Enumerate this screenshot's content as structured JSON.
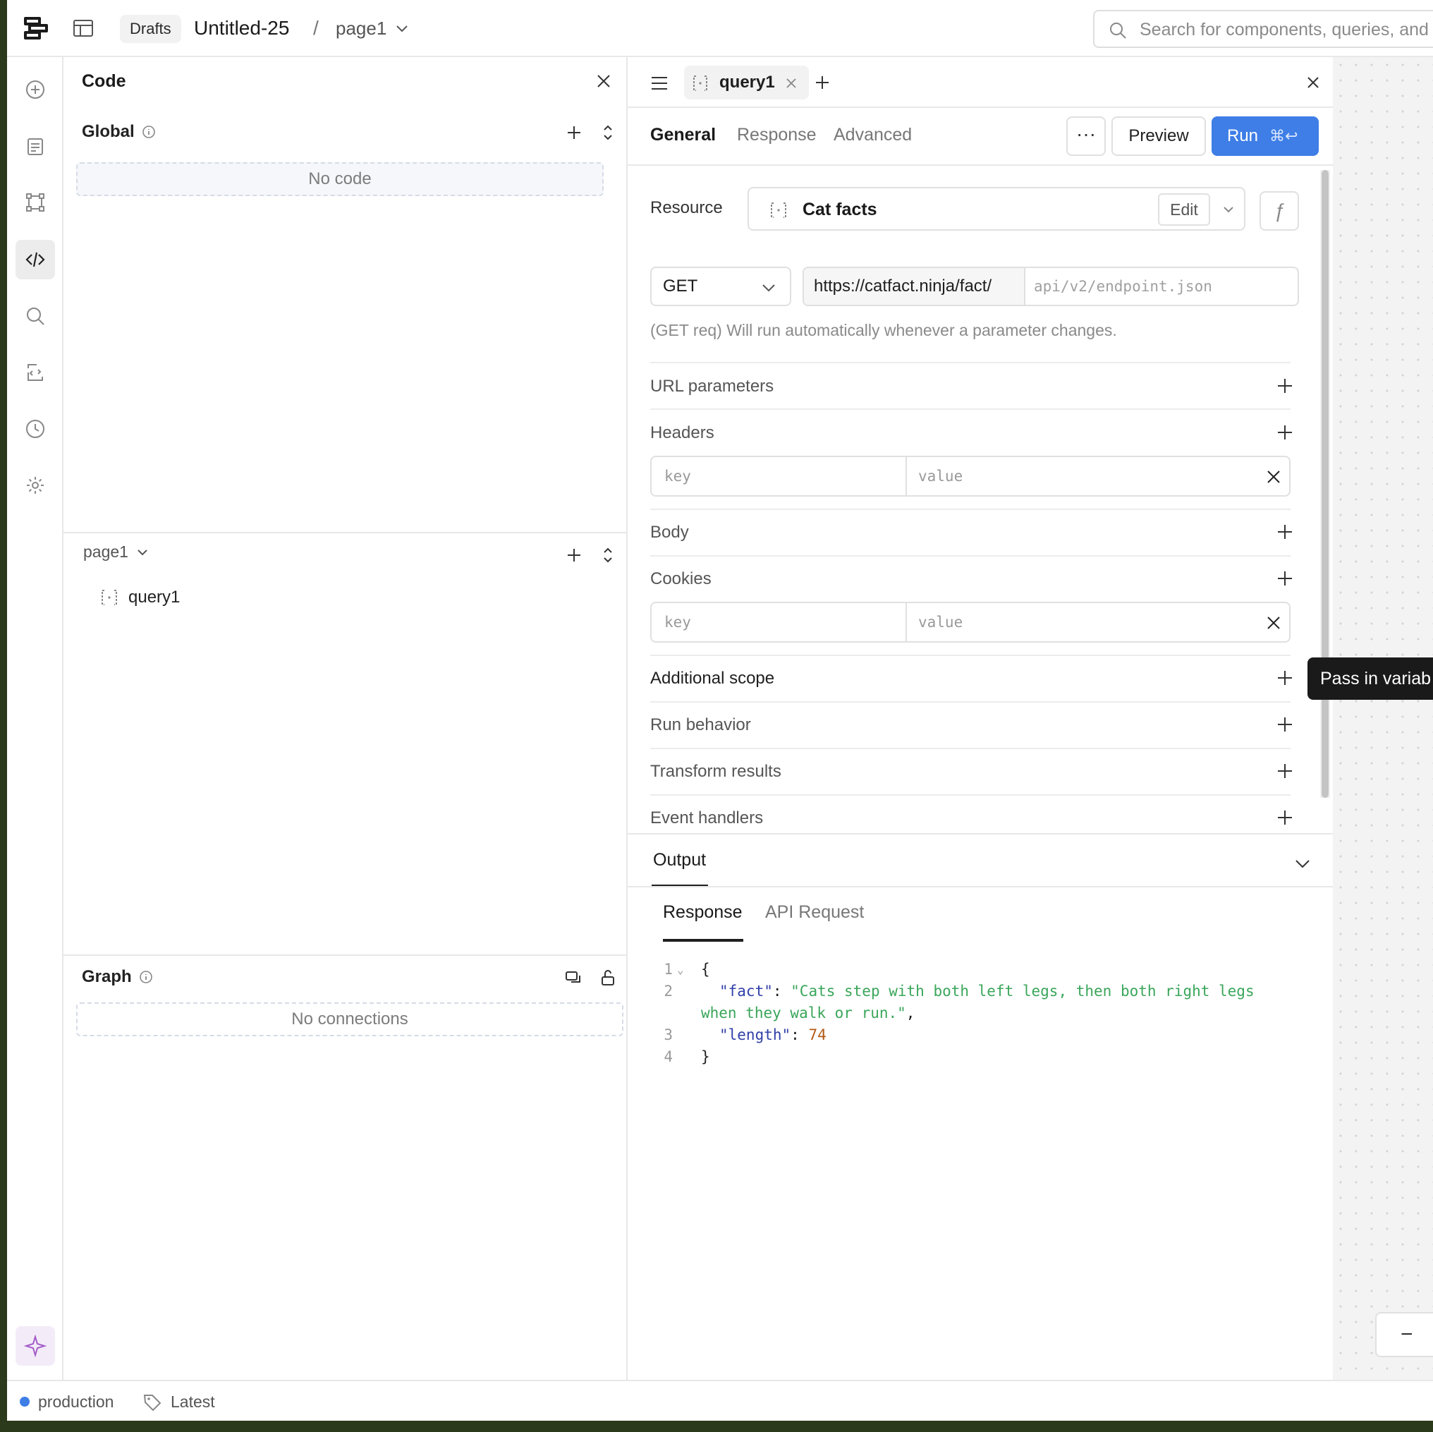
{
  "header": {
    "drafts_label": "Drafts",
    "app_title": "Untitled-25",
    "separator": "/",
    "page_name": "page1",
    "search_placeholder": "Search for components, queries, and"
  },
  "code_panel": {
    "title": "Code",
    "global": {
      "label": "Global",
      "empty_text": "No code"
    },
    "page": {
      "label": "page1",
      "items": [
        {
          "name": "query1"
        }
      ]
    },
    "graph": {
      "label": "Graph",
      "empty_text": "No connections"
    }
  },
  "editor": {
    "tab_name": "query1",
    "subtabs": [
      "General",
      "Response",
      "Advanced"
    ],
    "more_label": "···",
    "preview_label": "Preview",
    "run_label": "Run",
    "run_shortcut": "⌘↩",
    "resource_label": "Resource",
    "resource_name": "Cat facts",
    "edit_label": "Edit",
    "fx_label": "ƒ",
    "method": "GET",
    "url_base": "https://catfact.ninja/fact/",
    "url_placeholder": "api/v2/endpoint.json",
    "hint": "(GET req) Will run automatically whenever a parameter changes.",
    "sections": {
      "url_parameters": "URL parameters",
      "headers": "Headers",
      "body": "Body",
      "cookies": "Cookies",
      "additional_scope": "Additional scope",
      "run_behavior": "Run behavior",
      "transform_results": "Transform results",
      "event_handlers": "Event handlers"
    },
    "kv_key_placeholder": "key",
    "kv_value_placeholder": "value",
    "tooltip": "Pass in variab"
  },
  "output": {
    "title": "Output",
    "tabs": [
      "Response",
      "API Request"
    ],
    "line_numbers": [
      "1",
      "2",
      "",
      "3",
      "4"
    ],
    "json": {
      "open": "{",
      "fact_key": "\"fact\"",
      "fact_value_line1": "\"Cats step with both left legs, then both right legs",
      "fact_value_line2": "when they walk or run.\"",
      "length_key": "\"length\"",
      "length_value": "74",
      "close": "}"
    }
  },
  "canvas": {
    "zoom_out_label": "−"
  },
  "status": {
    "environment": "production",
    "version": "Latest",
    "env_color": "#3e7ee6"
  },
  "colors": {
    "accent": "#3e7ee6",
    "tooltip_bg": "#1a1a1a"
  }
}
